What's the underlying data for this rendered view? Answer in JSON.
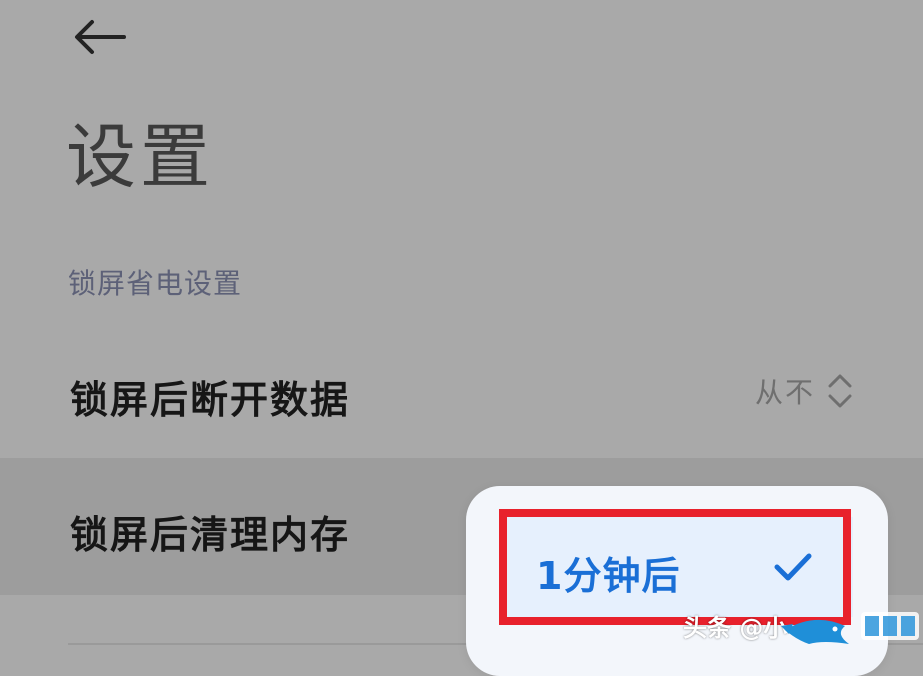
{
  "header": {
    "back_icon": "arrow-left-icon"
  },
  "page": {
    "title": "设置"
  },
  "section": {
    "label": "锁屏省电设置"
  },
  "rows": [
    {
      "label": "锁屏后断开数据",
      "value": "从不",
      "icon": "chevron-up-down-icon"
    },
    {
      "label": "锁屏后清理内存"
    }
  ],
  "popup": {
    "options": [
      {
        "label": "1分钟后",
        "selected": true,
        "icon": "check-icon"
      }
    ]
  },
  "watermark": {
    "text": "头条 @小"
  },
  "colors": {
    "background": "#a9a9a9",
    "accent": "#1a6fd6",
    "highlight": "#e8212c",
    "popup": "#f3f6fb"
  }
}
